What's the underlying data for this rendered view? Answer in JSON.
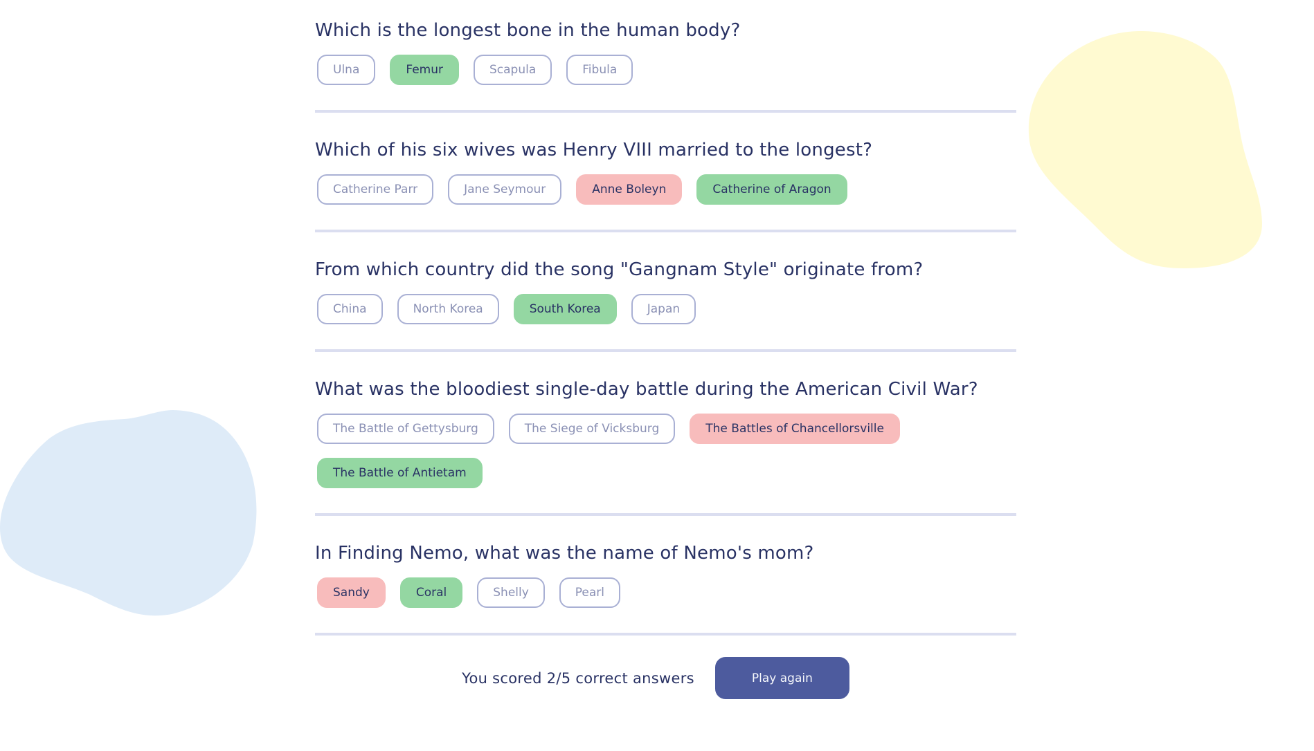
{
  "colors": {
    "title": "#293264",
    "correct": "#94D7A2",
    "wrong": "#F8BCBC",
    "neutral_border": "#A9B0D4",
    "divider": "#DBDEF0",
    "button": "#4D5B9E",
    "blob_yellow": "#FFFAD1",
    "blob_blue": "#DEEBF8"
  },
  "questions": [
    {
      "question": "Which is the longest bone in the human body?",
      "answers": [
        {
          "label": "Ulna",
          "state": "neutral"
        },
        {
          "label": "Femur",
          "state": "correct"
        },
        {
          "label": "Scapula",
          "state": "neutral"
        },
        {
          "label": "Fibula",
          "state": "neutral"
        }
      ]
    },
    {
      "question": "Which of his six wives was Henry VIII married to the longest?",
      "answers": [
        {
          "label": "Catherine Parr",
          "state": "neutral"
        },
        {
          "label": "Jane Seymour",
          "state": "neutral"
        },
        {
          "label": "Anne Boleyn",
          "state": "wrong"
        },
        {
          "label": "Catherine of Aragon",
          "state": "correct"
        }
      ]
    },
    {
      "question": "From which country did the song \"Gangnam Style\" originate from?",
      "answers": [
        {
          "label": "China",
          "state": "neutral"
        },
        {
          "label": "North Korea",
          "state": "neutral"
        },
        {
          "label": "South Korea",
          "state": "correct"
        },
        {
          "label": "Japan",
          "state": "neutral"
        }
      ]
    },
    {
      "question": "What was the bloodiest single-day battle during the American Civil War?",
      "answers": [
        {
          "label": "The Battle of Gettysburg",
          "state": "neutral"
        },
        {
          "label": "The Siege of Vicksburg",
          "state": "neutral"
        },
        {
          "label": "The Battles of Chancellorsville",
          "state": "wrong"
        },
        {
          "label": "The Battle of Antietam",
          "state": "correct"
        }
      ]
    },
    {
      "question": "In Finding Nemo, what was the name of Nemo's mom?",
      "answers": [
        {
          "label": "Sandy",
          "state": "wrong"
        },
        {
          "label": "Coral",
          "state": "correct"
        },
        {
          "label": "Shelly",
          "state": "neutral"
        },
        {
          "label": "Pearl",
          "state": "neutral"
        }
      ]
    }
  ],
  "result": {
    "score_text": "You scored 2/5 correct answers",
    "correct_count": 2,
    "total": 5,
    "play_again_label": "Play again"
  }
}
